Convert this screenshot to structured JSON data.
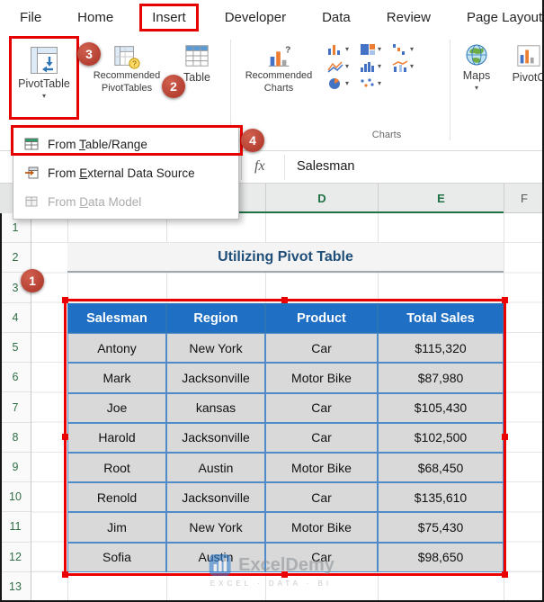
{
  "tabs": [
    "File",
    "Home",
    "Insert",
    "Developer",
    "Data",
    "Review",
    "Page Layout"
  ],
  "ribbon": {
    "pivottable_label": "PivotTable",
    "recommended_pivottables_line1": "Recommended",
    "recommended_pivottables_line2": "PivotTables",
    "table_label": "Table",
    "recommended_charts_line1": "Recommended",
    "recommended_charts_line2": "Charts",
    "maps_label": "Maps",
    "pivotchart_label": "PivotC",
    "charts_group_label": "Charts"
  },
  "menu": {
    "items": [
      {
        "pre": "From ",
        "key": "T",
        "post": "able/Range"
      },
      {
        "pre": "From ",
        "key": "E",
        "post": "xternal Data Source"
      },
      {
        "pre": "From ",
        "key": "D",
        "post": "ata Model"
      }
    ]
  },
  "formula_bar": {
    "fx_label": "fx",
    "value": "Salesman"
  },
  "sheet": {
    "visible_columns": [
      "D",
      "E",
      "F"
    ],
    "row_numbers": [
      "1",
      "2",
      "3",
      "4",
      "5",
      "6",
      "7",
      "8",
      "9",
      "10",
      "11",
      "12",
      "13"
    ],
    "title": "Utilizing Pivot Table"
  },
  "data_table": {
    "headers": [
      "Salesman",
      "Region",
      "Product",
      "Total Sales"
    ],
    "rows": [
      [
        "Antony",
        "New York",
        "Car",
        "$115,320"
      ],
      [
        "Mark",
        "Jacksonville",
        "Motor Bike",
        "$87,980"
      ],
      [
        "Joe",
        "kansas",
        "Car",
        "$105,430"
      ],
      [
        "Harold",
        "Jacksonville",
        "Car",
        "$102,500"
      ],
      [
        "Root",
        "Austin",
        "Motor Bike",
        "$68,450"
      ],
      [
        "Renold",
        "Jacksonville",
        "Car",
        "$135,610"
      ],
      [
        "Jim",
        "New York",
        "Motor Bike",
        "$75,430"
      ],
      [
        "Sofia",
        "Austin",
        "Car",
        "$98,650"
      ]
    ]
  },
  "badges": {
    "one": "1",
    "two": "2",
    "three": "3",
    "four": "4"
  },
  "icons": {
    "chevron_down": "▾"
  },
  "watermark": {
    "brand": "ExcelDemy",
    "tagline": "EXCEL · DATA · BI"
  },
  "colors": {
    "table_header_blue": "#1F6FC4",
    "cell_gray": "#D9D9D9",
    "annotation_red": "#E60000",
    "badge_red": "#A93226",
    "title_blue": "#1F4E79",
    "excel_green": "#1E7145"
  }
}
